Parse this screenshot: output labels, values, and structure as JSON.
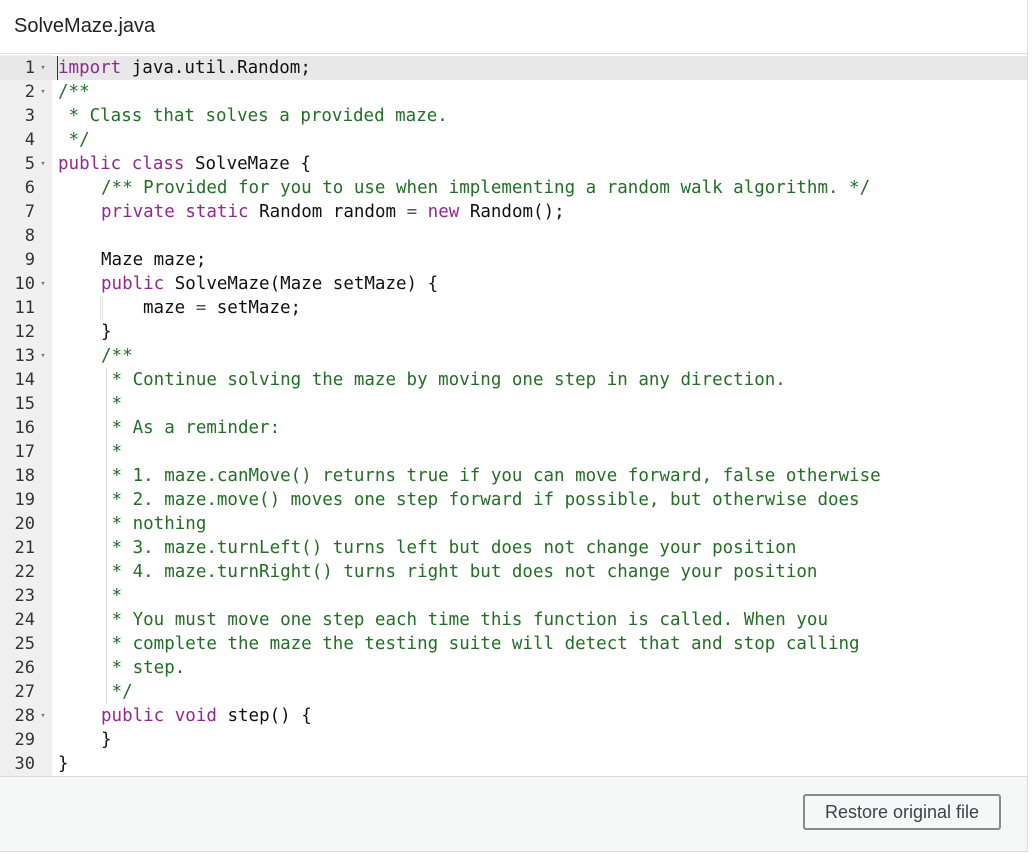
{
  "file": {
    "name": "SolveMaze.java"
  },
  "editor": {
    "lines": [
      {
        "num": "1",
        "fold": true,
        "indent": 0,
        "tokens": [
          [
            "kw",
            "import"
          ],
          [
            "pl",
            " java.util.Random;"
          ]
        ]
      },
      {
        "num": "2",
        "fold": true,
        "indent": 0,
        "tokens": [
          [
            "cm",
            "/**"
          ]
        ]
      },
      {
        "num": "3",
        "fold": false,
        "indent": 0,
        "tokens": [
          [
            "cm",
            " * Class that solves a provided maze."
          ]
        ]
      },
      {
        "num": "4",
        "fold": false,
        "indent": 0,
        "tokens": [
          [
            "cm",
            " */"
          ]
        ]
      },
      {
        "num": "5",
        "fold": true,
        "indent": 0,
        "tokens": [
          [
            "kw",
            "public"
          ],
          [
            "pl",
            " "
          ],
          [
            "kw",
            "class"
          ],
          [
            "pl",
            " SolveMaze {"
          ]
        ]
      },
      {
        "num": "6",
        "fold": false,
        "indent": 1,
        "tokens": [
          [
            "cm",
            "/** Provided for you to use when implementing a random walk algorithm. */"
          ]
        ]
      },
      {
        "num": "7",
        "fold": false,
        "indent": 1,
        "tokens": [
          [
            "kw",
            "private"
          ],
          [
            "pl",
            " "
          ],
          [
            "kw",
            "static"
          ],
          [
            "pl",
            " Random random "
          ],
          [
            "op",
            "="
          ],
          [
            "pl",
            " "
          ],
          [
            "kw",
            "new"
          ],
          [
            "pl",
            " Random();"
          ]
        ]
      },
      {
        "num": "8",
        "fold": false,
        "indent": 1,
        "tokens": []
      },
      {
        "num": "9",
        "fold": false,
        "indent": 1,
        "tokens": [
          [
            "pl",
            "Maze maze;"
          ]
        ]
      },
      {
        "num": "10",
        "fold": true,
        "indent": 1,
        "tokens": [
          [
            "kw",
            "public"
          ],
          [
            "pl",
            " SolveMaze(Maze setMaze) {"
          ]
        ]
      },
      {
        "num": "11",
        "fold": false,
        "indent": 2,
        "tokens": [
          [
            "pl",
            "maze "
          ],
          [
            "op",
            "="
          ],
          [
            "pl",
            " setMaze;"
          ]
        ]
      },
      {
        "num": "12",
        "fold": false,
        "indent": 1,
        "tokens": [
          [
            "pl",
            "}"
          ]
        ]
      },
      {
        "num": "13",
        "fold": true,
        "indent": 1,
        "tokens": [
          [
            "cm",
            "/**"
          ]
        ]
      },
      {
        "num": "14",
        "fold": false,
        "indent": 1,
        "tokens": [
          [
            "cm",
            " * Continue solving the maze by moving one step in any direction."
          ]
        ]
      },
      {
        "num": "15",
        "fold": false,
        "indent": 1,
        "tokens": [
          [
            "cm",
            " *"
          ]
        ]
      },
      {
        "num": "16",
        "fold": false,
        "indent": 1,
        "tokens": [
          [
            "cm",
            " * As a reminder:"
          ]
        ]
      },
      {
        "num": "17",
        "fold": false,
        "indent": 1,
        "tokens": [
          [
            "cm",
            " *"
          ]
        ]
      },
      {
        "num": "18",
        "fold": false,
        "indent": 1,
        "tokens": [
          [
            "cm",
            " * 1. maze.canMove() returns true if you can move forward, false otherwise"
          ]
        ]
      },
      {
        "num": "19",
        "fold": false,
        "indent": 1,
        "tokens": [
          [
            "cm",
            " * 2. maze.move() moves one step forward if possible, but otherwise does"
          ]
        ]
      },
      {
        "num": "20",
        "fold": false,
        "indent": 1,
        "tokens": [
          [
            "cm",
            " * nothing"
          ]
        ]
      },
      {
        "num": "21",
        "fold": false,
        "indent": 1,
        "tokens": [
          [
            "cm",
            " * 3. maze.turnLeft() turns left but does not change your position"
          ]
        ]
      },
      {
        "num": "22",
        "fold": false,
        "indent": 1,
        "tokens": [
          [
            "cm",
            " * 4. maze.turnRight() turns right but does not change your position"
          ]
        ]
      },
      {
        "num": "23",
        "fold": false,
        "indent": 1,
        "tokens": [
          [
            "cm",
            " *"
          ]
        ]
      },
      {
        "num": "24",
        "fold": false,
        "indent": 1,
        "tokens": [
          [
            "cm",
            " * You must move one step each time this function is called. When you"
          ]
        ]
      },
      {
        "num": "25",
        "fold": false,
        "indent": 1,
        "tokens": [
          [
            "cm",
            " * complete the maze the testing suite will detect that and stop calling"
          ]
        ]
      },
      {
        "num": "26",
        "fold": false,
        "indent": 1,
        "tokens": [
          [
            "cm",
            " * step."
          ]
        ]
      },
      {
        "num": "27",
        "fold": false,
        "indent": 1,
        "tokens": [
          [
            "cm",
            " */"
          ]
        ]
      },
      {
        "num": "28",
        "fold": true,
        "indent": 1,
        "tokens": [
          [
            "kw",
            "public"
          ],
          [
            "pl",
            " "
          ],
          [
            "kw",
            "void"
          ],
          [
            "pl",
            " step() {"
          ]
        ]
      },
      {
        "num": "29",
        "fold": false,
        "indent": 1,
        "tokens": [
          [
            "pl",
            "}"
          ]
        ]
      },
      {
        "num": "30",
        "fold": false,
        "indent": 0,
        "tokens": [
          [
            "pl",
            "}"
          ]
        ]
      }
    ],
    "active_line": "1",
    "fold_icon": "chevron-down-icon",
    "colors": {
      "keyword": "#93278f",
      "comment": "#236e25",
      "gutter": "#f0f0f0",
      "active_line": "#e8e8e8"
    }
  },
  "footer": {
    "restore_label": "Restore original file"
  }
}
